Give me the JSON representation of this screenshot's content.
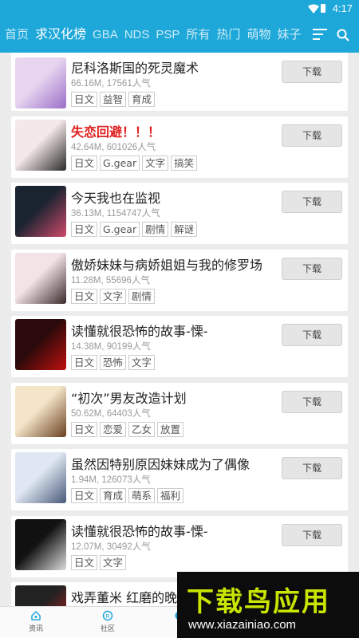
{
  "status": {
    "time": "4:17"
  },
  "nav": {
    "tabs": [
      "首页",
      "求汉化榜",
      "GBA",
      "NDS",
      "PSP",
      "所有",
      "热门",
      "萌物",
      "妹子"
    ],
    "active_index": 1,
    "accent": "#1ea7d9"
  },
  "games": [
    {
      "title": "尼科洛斯国的死灵魔术",
      "size": "66.16M",
      "popularity": "17561人气",
      "tags": [
        "日文",
        "益智",
        "育成"
      ],
      "button": "下载",
      "title_red": false
    },
    {
      "title": "失恋回避！！！",
      "size": "42.64M",
      "popularity": "601026人气",
      "tags": [
        "日文",
        "G.gear",
        "文字",
        "搞笑"
      ],
      "button": "下载",
      "title_red": true
    },
    {
      "title": "今天我也在监视",
      "size": "36.13M",
      "popularity": "1154747人气",
      "tags": [
        "日文",
        "G.gear",
        "剧情",
        "解谜"
      ],
      "button": "下载",
      "title_red": false
    },
    {
      "title": "傲娇妹妹与病娇姐姐与我的修罗场",
      "size": "11.28M",
      "popularity": "55696人气",
      "tags": [
        "日文",
        "文字",
        "剧情"
      ],
      "button": "下载",
      "title_red": false
    },
    {
      "title": "读懂就很恐怖的故事-慄-",
      "size": "14.38M",
      "popularity": "90199人气",
      "tags": [
        "日文",
        "恐怖",
        "文字"
      ],
      "button": "下载",
      "title_red": false
    },
    {
      "title": "“初次”男友改造计划",
      "size": "50.62M",
      "popularity": "64403人气",
      "tags": [
        "日文",
        "恋爱",
        "乙女",
        "放置"
      ],
      "button": "下载",
      "title_red": false
    },
    {
      "title": "虽然因特别原因妹妹成为了偶像",
      "size": "1.94M",
      "popularity": "126073人气",
      "tags": [
        "日文",
        "育成",
        "萌系",
        "福利"
      ],
      "button": "下载",
      "title_red": false
    },
    {
      "title": "读懂就很恐怖的故事-慄-",
      "size": "12.07M",
      "popularity": "30492人气",
      "tags": [
        "日文",
        "文字"
      ],
      "button": "下载",
      "title_red": false
    },
    {
      "title": "戏弄董米 红磨的晚",
      "size": "",
      "popularity": "",
      "tags": [],
      "button": "",
      "title_red": false
    }
  ],
  "bottom": {
    "items": [
      {
        "label": "资讯",
        "icon": "home-icon"
      },
      {
        "label": "社区",
        "icon": "community-icon"
      },
      {
        "label": "",
        "icon": "game-icon"
      }
    ]
  },
  "watermark": {
    "title": "下载鸟应用",
    "url": "www.xiazainiao.com"
  }
}
